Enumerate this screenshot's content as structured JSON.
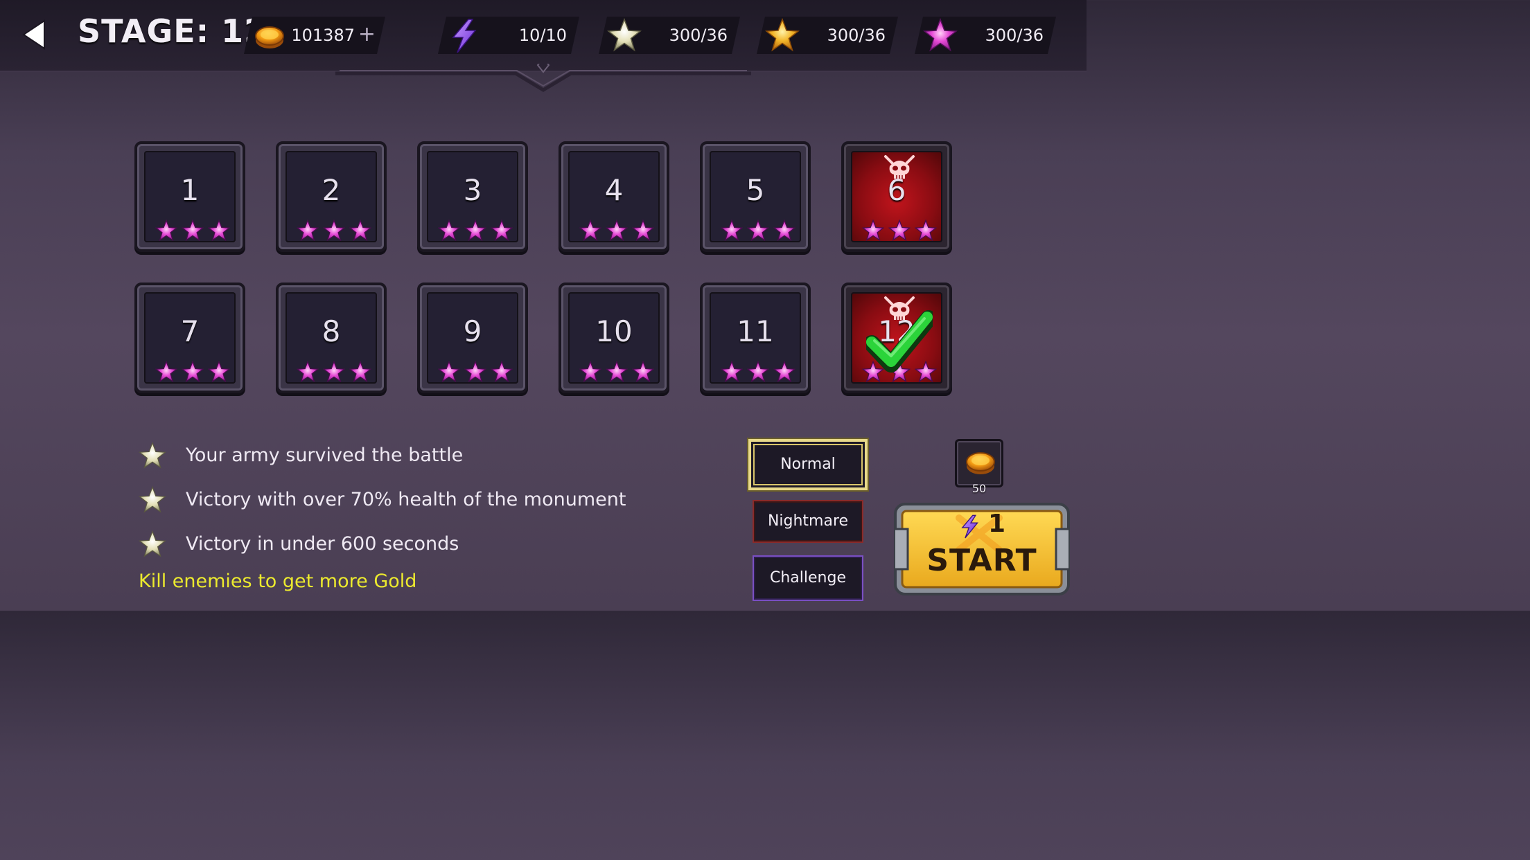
{
  "header": {
    "stage_title": "STAGE: 12",
    "gold": "101387",
    "gold_add_label": "+",
    "energy": "10/10",
    "silver_stars": "300/36",
    "gold_stars": "300/36",
    "pink_stars": "300/36"
  },
  "levels": [
    {
      "label": "1",
      "stars": 3,
      "boss": false
    },
    {
      "label": "2",
      "stars": 3,
      "boss": false
    },
    {
      "label": "3",
      "stars": 3,
      "boss": false
    },
    {
      "label": "4",
      "stars": 3,
      "boss": false
    },
    {
      "label": "5",
      "stars": 3,
      "boss": false
    },
    {
      "label": "6",
      "stars": 3,
      "boss": true
    },
    {
      "label": "7",
      "stars": 3,
      "boss": false
    },
    {
      "label": "8",
      "stars": 3,
      "boss": false
    },
    {
      "label": "9",
      "stars": 3,
      "boss": false
    },
    {
      "label": "10",
      "stars": 3,
      "boss": false
    },
    {
      "label": "11",
      "stars": 3,
      "boss": false
    },
    {
      "label": "12",
      "stars": 3,
      "boss": true,
      "selected": true
    }
  ],
  "objectives": [
    "Your army survived the battle",
    "Victory with over 70% health of the monument",
    "Victory in under 600 seconds"
  ],
  "hint": "Kill enemies to get more Gold",
  "difficulty": {
    "options": [
      "Normal",
      "Nightmare",
      "Challenge"
    ],
    "selected": "Normal"
  },
  "reward": {
    "amount": "50"
  },
  "start": {
    "label": "START",
    "energy_cost": "1"
  },
  "colors": {
    "hint_yellow": "#ecea2e",
    "boss_red": "#c0141c",
    "start_gold": "#f2c233",
    "star_pink": "#e040d8"
  },
  "icons": {
    "back": "back-arrow-icon",
    "gold": "gold-coin-icon",
    "energy": "lightning-bolt-icon",
    "silver_star": "silver-star-icon",
    "gold_star": "gold-star-icon",
    "pink_star": "pink-star-icon",
    "boss": "skull-icon",
    "completed": "checkmark-icon"
  }
}
